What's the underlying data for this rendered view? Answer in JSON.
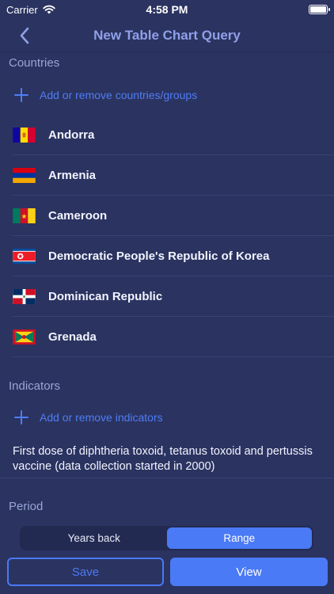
{
  "status_bar": {
    "carrier": "Carrier",
    "time": "4:58 PM",
    "battery_level": 1.0
  },
  "nav": {
    "title": "New Table Chart Query",
    "back_icon": "chevron-left-icon"
  },
  "countries": {
    "header": "Countries",
    "add_label": "Add or remove countries/groups",
    "items": [
      {
        "name": "Andorra",
        "flag_icon": "flag-andorra-icon"
      },
      {
        "name": "Armenia",
        "flag_icon": "flag-armenia-icon"
      },
      {
        "name": "Cameroon",
        "flag_icon": "flag-cameroon-icon"
      },
      {
        "name": "Democratic People's Republic of Korea",
        "flag_icon": "flag-north-korea-icon"
      },
      {
        "name": "Dominican Republic",
        "flag_icon": "flag-dominican-republic-icon"
      },
      {
        "name": "Grenada",
        "flag_icon": "flag-grenada-icon"
      }
    ]
  },
  "indicators": {
    "header": "Indicators",
    "add_label": "Add or remove indicators",
    "items": [
      {
        "text": "First dose of diphtheria toxoid, tetanus toxoid and pertussis vaccine (data collection started in 2000)"
      }
    ]
  },
  "period": {
    "header": "Period",
    "segments": [
      "Years back",
      "Range"
    ],
    "selected": "Range"
  },
  "actions": {
    "save_label": "Save",
    "view_label": "View"
  },
  "colors": {
    "background": "#2b3360",
    "accent": "#4a7af5",
    "section_header": "#9aa5d6"
  }
}
